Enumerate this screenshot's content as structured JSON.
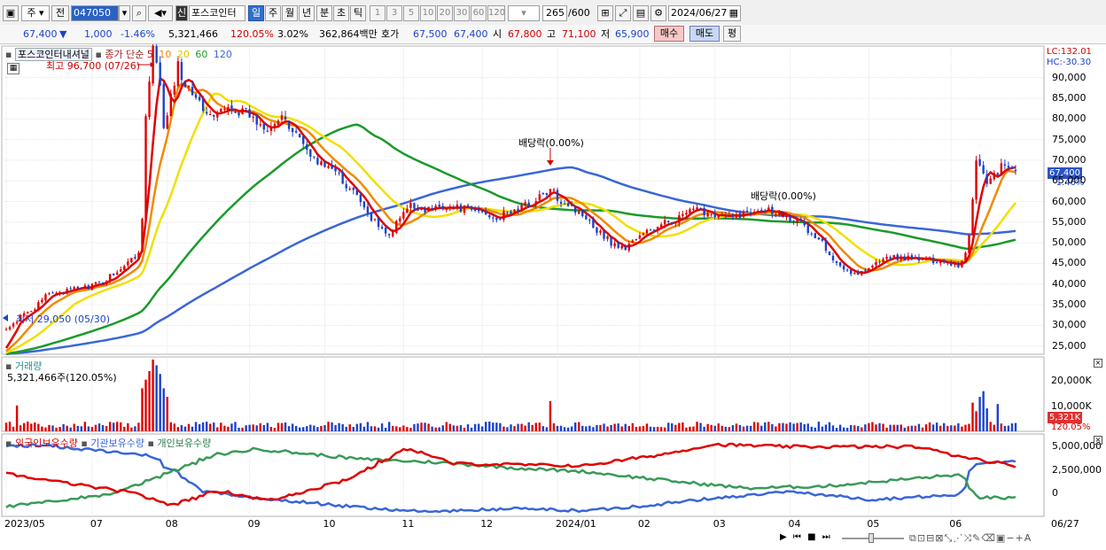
{
  "toolbar": {
    "period_select": "주",
    "prev_label": "전",
    "stock_code": "047050",
    "market_tag": "신",
    "stock_name": "포스코인터",
    "interval_tabs": [
      "일",
      "주",
      "월",
      "년",
      "분",
      "초",
      "틱"
    ],
    "active_interval": "일",
    "minute_options": [
      "1",
      "3",
      "5",
      "10",
      "20",
      "30",
      "60",
      "120"
    ],
    "data_count": "265",
    "data_max": "/600",
    "date": "2024/06/27"
  },
  "quote": {
    "price": "67,400",
    "change_symbol": "▼",
    "change": "1,000",
    "change_pct": "-1.46%",
    "volume": "5,321,466",
    "volume_ratio": "120.05%",
    "turnover": "3.02%",
    "amount": "362,864백만",
    "hoga_label": "호가",
    "ask": "67,500",
    "bid": "67,400",
    "open_label": "시",
    "open": "67,800",
    "high_label": "고",
    "high": "71,100",
    "low_label": "저",
    "low": "65,900",
    "buy_label": "매수",
    "sell_label": "매도",
    "flat_label": "평"
  },
  "price_panel": {
    "title": "포스코인터내셔널",
    "legend_prefix": "종가 단순",
    "ma_labels": [
      "5",
      "10",
      "20",
      "60",
      "120"
    ],
    "lc_label": "LC:132.01",
    "hc_label": "HC:-30.30",
    "high_annotation": "최고 96,700 (07/26)",
    "low_annotation": "최저 29,050 (05/30)",
    "dividend_label_1": "배당락(0.00%)",
    "dividend_label_2": "배당락(0.00%)",
    "current_price_badge": "67,400",
    "current_change_badge": "-1.46%",
    "y_ticks": [
      "90,000",
      "85,000",
      "80,000",
      "75,000",
      "70,000",
      "65,000",
      "60,000",
      "55,000",
      "50,000",
      "45,000",
      "40,000",
      "35,000",
      "30,000",
      "25,000"
    ]
  },
  "volume_panel": {
    "title": "거래량",
    "value_label": "5,321,466주(120.05%)",
    "y_ticks": [
      "20,000K",
      "10,000K"
    ],
    "badge_value": "5,321K",
    "badge_pct": "120.05%"
  },
  "holding_panel": {
    "legend": [
      "외국인보유수량",
      "기관보유수량",
      "개인보유수량"
    ],
    "y_ticks": [
      "5,000,000",
      "2,500,000",
      "0"
    ]
  },
  "x_axis": {
    "labels": [
      "2023/05",
      "07",
      "08",
      "09",
      "10",
      "11",
      "12",
      "2024/01",
      "02",
      "03",
      "04",
      "05",
      "06",
      "06/27"
    ]
  },
  "colors": {
    "up": "#e00000",
    "down": "#1c43c9",
    "ma5": "#e00000",
    "ma10": "#f08a00",
    "ma20": "#f0e000",
    "ma60": "#1a9a2a",
    "ma120": "#3a66d8",
    "foreign": "#e00000",
    "institution": "#3a66d8",
    "individual": "#3a9a5a"
  },
  "chart_data": {
    "type": "candlestick",
    "price_waypoints": [
      [
        "2023/05/30",
        29050
      ],
      [
        "2023/06/15",
        37500
      ],
      [
        "2023/07/05",
        40000
      ],
      [
        "2023/07/14",
        44000
      ],
      [
        "2023/07/20",
        47500
      ],
      [
        "2023/07/26",
        96700
      ],
      [
        "2023/07/31",
        77000
      ],
      [
        "2023/08/04",
        93000
      ],
      [
        "2023/08/11",
        86000
      ],
      [
        "2023/08/18",
        80000
      ],
      [
        "2023/08/25",
        83000
      ],
      [
        "2023/09/01",
        81000
      ],
      [
        "2023/09/08",
        78000
      ],
      [
        "2023/09/15",
        80000
      ],
      [
        "2023/09/22",
        75000
      ],
      [
        "2023/09/27",
        70000
      ],
      [
        "2023/10/06",
        67000
      ],
      [
        "2023/10/13",
        62000
      ],
      [
        "2023/10/20",
        55000
      ],
      [
        "2023/10/27",
        52000
      ],
      [
        "2023/11/03",
        59000
      ],
      [
        "2023/11/10",
        58000
      ],
      [
        "2023/11/17",
        59000
      ],
      [
        "2023/12/01",
        57500
      ],
      [
        "2023/12/08",
        56000
      ],
      [
        "2023/12/15",
        58000
      ],
      [
        "2023/12/22",
        60000
      ],
      [
        "2023/12/28",
        62500
      ],
      [
        "2024/01/05",
        59000
      ],
      [
        "2024/01/12",
        56000
      ],
      [
        "2024/01/19",
        51000
      ],
      [
        "2024/01/26",
        48500
      ],
      [
        "2024/02/02",
        52000
      ],
      [
        "2024/02/16",
        56000
      ],
      [
        "2024/02/23",
        58000
      ],
      [
        "2024/03/08",
        56000
      ],
      [
        "2024/03/20",
        58500
      ],
      [
        "2024/03/29",
        57000
      ],
      [
        "2024/04/05",
        54500
      ],
      [
        "2024/04/12",
        50000
      ],
      [
        "2024/04/19",
        45000
      ],
      [
        "2024/04/26",
        42000
      ],
      [
        "2024/05/03",
        45000
      ],
      [
        "2024/05/10",
        46500
      ],
      [
        "2024/05/20",
        46000
      ],
      [
        "2024/05/31",
        45500
      ],
      [
        "2024/06/05",
        44500
      ],
      [
        "2024/06/10",
        52000
      ],
      [
        "2024/06/12",
        70000
      ],
      [
        "2024/06/17",
        64000
      ],
      [
        "2024/06/21",
        68500
      ],
      [
        "2024/06/27",
        67400
      ]
    ],
    "volume_spikes": [
      [
        "2023/06/02",
        9000
      ],
      [
        "2023/07/21",
        15000
      ],
      [
        "2023/07/24",
        18000
      ],
      [
        "2023/07/25",
        21000
      ],
      [
        "2023/07/26",
        25000
      ],
      [
        "2023/07/27",
        23000
      ],
      [
        "2023/07/28",
        20000
      ],
      [
        "2023/07/31",
        15000
      ],
      [
        "2023/08/01",
        12000
      ],
      [
        "2023/12/28",
        10500
      ],
      [
        "2024/06/11",
        10000
      ],
      [
        "2024/06/12",
        7000
      ],
      [
        "2024/06/13",
        12000
      ],
      [
        "2024/06/14",
        14000
      ],
      [
        "2024/06/17",
        8000
      ],
      [
        "2024/06/20",
        9500
      ]
    ],
    "ylim": [
      23000,
      97000
    ],
    "volume_ylim": [
      0,
      25000
    ],
    "holding_ylim": [
      -1500000,
      5600000
    ],
    "holding_waypoints": {
      "foreign": [
        [
          "2023/05/01",
          3200000
        ],
        [
          "2023/06/01",
          2200000
        ],
        [
          "2023/07/20",
          500000
        ],
        [
          "2023/08/02",
          -500000
        ],
        [
          "2023/08/20",
          800000
        ],
        [
          "2023/09/10",
          -100000
        ],
        [
          "2023/10/10",
          1800000
        ],
        [
          "2023/11/03",
          4600000
        ],
        [
          "2023/11/20",
          3200000
        ],
        [
          "2024/01/10",
          3000000
        ],
        [
          "2024/02/10",
          4000000
        ],
        [
          "2024/03/01",
          4900000
        ],
        [
          "2024/04/01",
          4700000
        ],
        [
          "2024/05/20",
          4700000
        ],
        [
          "2024/06/05",
          3900000
        ],
        [
          "2024/06/27",
          3000000
        ]
      ],
      "institution": [
        [
          "2023/05/01",
          4800000
        ],
        [
          "2023/06/15",
          4800000
        ],
        [
          "2023/07/25",
          3900000
        ],
        [
          "2023/08/15",
          700000
        ],
        [
          "2023/09/10",
          0
        ],
        [
          "2023/10/15",
          -700000
        ],
        [
          "2023/11/10",
          -1100000
        ],
        [
          "2023/12/15",
          -800000
        ],
        [
          "2024/01/10",
          -1000000
        ],
        [
          "2024/02/01",
          -600000
        ],
        [
          "2024/03/01",
          100000
        ],
        [
          "2024/04/01",
          700000
        ],
        [
          "2024/05/01",
          0
        ],
        [
          "2024/06/05",
          400000
        ],
        [
          "2024/06/12",
          3200000
        ],
        [
          "2024/06/27",
          3500000
        ]
      ],
      "individual": [
        [
          "2023/05/01",
          -800000
        ],
        [
          "2023/06/01",
          -600000
        ],
        [
          "2023/07/10",
          500000
        ],
        [
          "2023/07/25",
          1800000
        ],
        [
          "2023/08/20",
          4000000
        ],
        [
          "2023/09/05",
          4500000
        ],
        [
          "2023/10/15",
          3600000
        ],
        [
          "2023/11/15",
          3300000
        ],
        [
          "2023/12/15",
          2800000
        ],
        [
          "2024/01/10",
          2500000
        ],
        [
          "2024/02/20",
          1500000
        ],
        [
          "2024/03/15",
          1000000
        ],
        [
          "2024/04/15",
          1200000
        ],
        [
          "2024/05/20",
          1900000
        ],
        [
          "2024/06/05",
          2200000
        ],
        [
          "2024/06/13",
          200000
        ],
        [
          "2024/06/27",
          100000
        ]
      ]
    }
  }
}
